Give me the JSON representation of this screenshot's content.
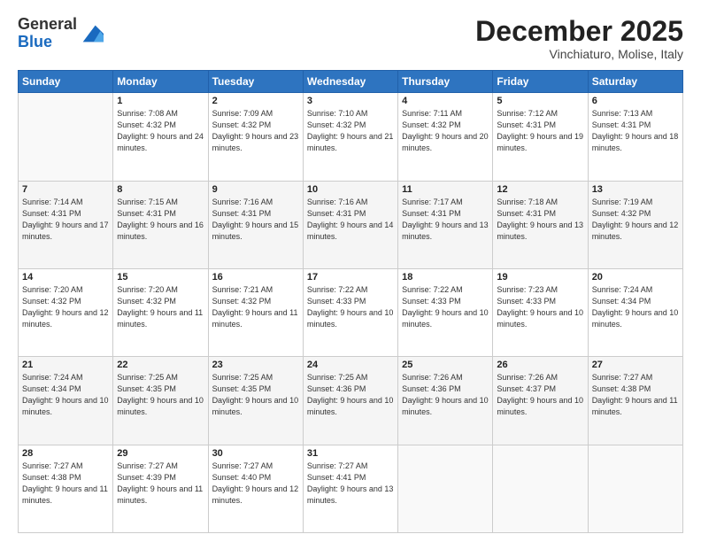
{
  "header": {
    "logo_general": "General",
    "logo_blue": "Blue",
    "month": "December 2025",
    "location": "Vinchiaturo, Molise, Italy"
  },
  "weekdays": [
    "Sunday",
    "Monday",
    "Tuesday",
    "Wednesday",
    "Thursday",
    "Friday",
    "Saturday"
  ],
  "weeks": [
    [
      {
        "day": "",
        "sunrise": "",
        "sunset": "",
        "daylight": ""
      },
      {
        "day": "1",
        "sunrise": "7:08 AM",
        "sunset": "4:32 PM",
        "daylight": "9 hours and 24 minutes."
      },
      {
        "day": "2",
        "sunrise": "7:09 AM",
        "sunset": "4:32 PM",
        "daylight": "9 hours and 23 minutes."
      },
      {
        "day": "3",
        "sunrise": "7:10 AM",
        "sunset": "4:32 PM",
        "daylight": "9 hours and 21 minutes."
      },
      {
        "day": "4",
        "sunrise": "7:11 AM",
        "sunset": "4:32 PM",
        "daylight": "9 hours and 20 minutes."
      },
      {
        "day": "5",
        "sunrise": "7:12 AM",
        "sunset": "4:31 PM",
        "daylight": "9 hours and 19 minutes."
      },
      {
        "day": "6",
        "sunrise": "7:13 AM",
        "sunset": "4:31 PM",
        "daylight": "9 hours and 18 minutes."
      }
    ],
    [
      {
        "day": "7",
        "sunrise": "7:14 AM",
        "sunset": "4:31 PM",
        "daylight": "9 hours and 17 minutes."
      },
      {
        "day": "8",
        "sunrise": "7:15 AM",
        "sunset": "4:31 PM",
        "daylight": "9 hours and 16 minutes."
      },
      {
        "day": "9",
        "sunrise": "7:16 AM",
        "sunset": "4:31 PM",
        "daylight": "9 hours and 15 minutes."
      },
      {
        "day": "10",
        "sunrise": "7:16 AM",
        "sunset": "4:31 PM",
        "daylight": "9 hours and 14 minutes."
      },
      {
        "day": "11",
        "sunrise": "7:17 AM",
        "sunset": "4:31 PM",
        "daylight": "9 hours and 13 minutes."
      },
      {
        "day": "12",
        "sunrise": "7:18 AM",
        "sunset": "4:31 PM",
        "daylight": "9 hours and 13 minutes."
      },
      {
        "day": "13",
        "sunrise": "7:19 AM",
        "sunset": "4:32 PM",
        "daylight": "9 hours and 12 minutes."
      }
    ],
    [
      {
        "day": "14",
        "sunrise": "7:20 AM",
        "sunset": "4:32 PM",
        "daylight": "9 hours and 12 minutes."
      },
      {
        "day": "15",
        "sunrise": "7:20 AM",
        "sunset": "4:32 PM",
        "daylight": "9 hours and 11 minutes."
      },
      {
        "day": "16",
        "sunrise": "7:21 AM",
        "sunset": "4:32 PM",
        "daylight": "9 hours and 11 minutes."
      },
      {
        "day": "17",
        "sunrise": "7:22 AM",
        "sunset": "4:33 PM",
        "daylight": "9 hours and 10 minutes."
      },
      {
        "day": "18",
        "sunrise": "7:22 AM",
        "sunset": "4:33 PM",
        "daylight": "9 hours and 10 minutes."
      },
      {
        "day": "19",
        "sunrise": "7:23 AM",
        "sunset": "4:33 PM",
        "daylight": "9 hours and 10 minutes."
      },
      {
        "day": "20",
        "sunrise": "7:24 AM",
        "sunset": "4:34 PM",
        "daylight": "9 hours and 10 minutes."
      }
    ],
    [
      {
        "day": "21",
        "sunrise": "7:24 AM",
        "sunset": "4:34 PM",
        "daylight": "9 hours and 10 minutes."
      },
      {
        "day": "22",
        "sunrise": "7:25 AM",
        "sunset": "4:35 PM",
        "daylight": "9 hours and 10 minutes."
      },
      {
        "day": "23",
        "sunrise": "7:25 AM",
        "sunset": "4:35 PM",
        "daylight": "9 hours and 10 minutes."
      },
      {
        "day": "24",
        "sunrise": "7:25 AM",
        "sunset": "4:36 PM",
        "daylight": "9 hours and 10 minutes."
      },
      {
        "day": "25",
        "sunrise": "7:26 AM",
        "sunset": "4:36 PM",
        "daylight": "9 hours and 10 minutes."
      },
      {
        "day": "26",
        "sunrise": "7:26 AM",
        "sunset": "4:37 PM",
        "daylight": "9 hours and 10 minutes."
      },
      {
        "day": "27",
        "sunrise": "7:27 AM",
        "sunset": "4:38 PM",
        "daylight": "9 hours and 11 minutes."
      }
    ],
    [
      {
        "day": "28",
        "sunrise": "7:27 AM",
        "sunset": "4:38 PM",
        "daylight": "9 hours and 11 minutes."
      },
      {
        "day": "29",
        "sunrise": "7:27 AM",
        "sunset": "4:39 PM",
        "daylight": "9 hours and 11 minutes."
      },
      {
        "day": "30",
        "sunrise": "7:27 AM",
        "sunset": "4:40 PM",
        "daylight": "9 hours and 12 minutes."
      },
      {
        "day": "31",
        "sunrise": "7:27 AM",
        "sunset": "4:41 PM",
        "daylight": "9 hours and 13 minutes."
      },
      {
        "day": "",
        "sunrise": "",
        "sunset": "",
        "daylight": ""
      },
      {
        "day": "",
        "sunrise": "",
        "sunset": "",
        "daylight": ""
      },
      {
        "day": "",
        "sunrise": "",
        "sunset": "",
        "daylight": ""
      }
    ]
  ],
  "labels": {
    "sunrise": "Sunrise:",
    "sunset": "Sunset:",
    "daylight": "Daylight:"
  }
}
